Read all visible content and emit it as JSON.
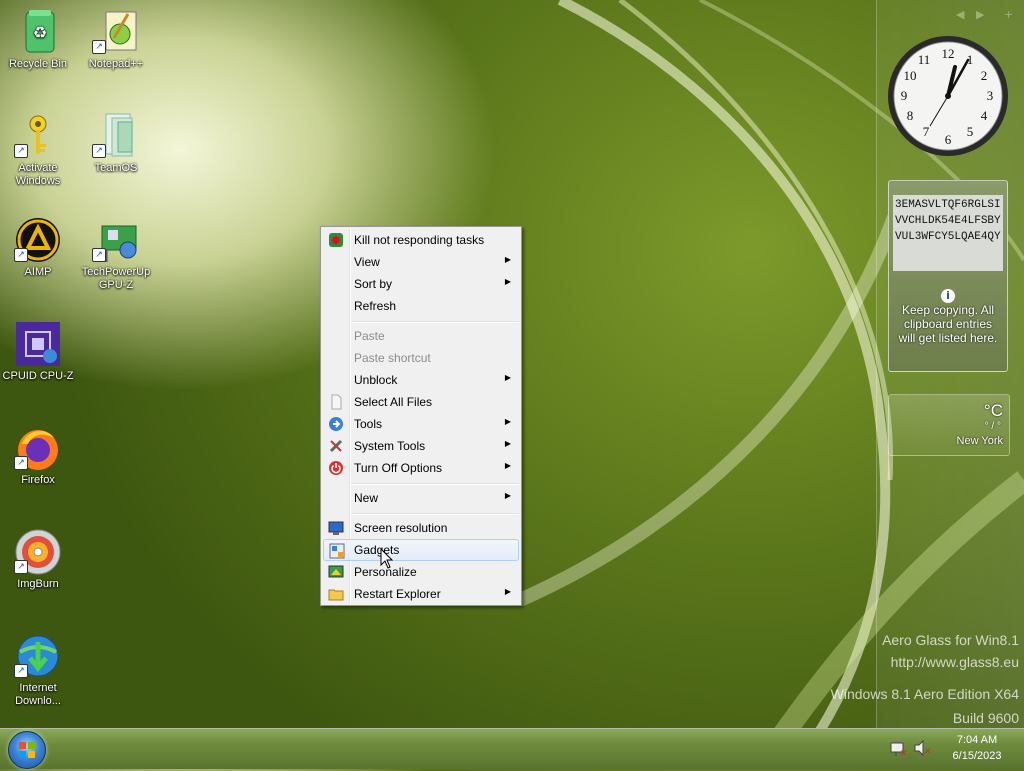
{
  "desktop": {
    "icons": [
      {
        "label": "Recycle Bin",
        "icon": "recycle-bin-icon"
      },
      {
        "label": "Notepad++",
        "icon": "notepad-plus-plus-icon"
      },
      {
        "label": "Activate Windows",
        "icon": "key-icon"
      },
      {
        "label": "TeamOS",
        "icon": "teamos-icon"
      },
      {
        "label": "AIMP",
        "icon": "aimp-icon"
      },
      {
        "label": "TechPowerUp GPU-Z",
        "icon": "gpu-z-icon"
      },
      {
        "label": "CPUID CPU-Z",
        "icon": "cpu-z-icon"
      },
      {
        "label": "Firefox",
        "icon": "firefox-icon"
      },
      {
        "label": "ImgBurn",
        "icon": "imgburn-icon"
      },
      {
        "label": "Internet Downlo...",
        "icon": "internet-download-manager-icon"
      }
    ]
  },
  "sidebar": {
    "controls": [
      "◀",
      "▶",
      "+"
    ],
    "clock": {
      "time": "7:04"
    },
    "clipboard": {
      "content": "3EMASVLTQF6RGLSIVVCHLDK54E4LFSBYVUL3WFCY5LQAE4QY",
      "info_icon": "i",
      "message": "Keep copying. All clipboard entries will get listed here."
    },
    "weather": {
      "unit": "°C",
      "range": "° / °",
      "city": "New York"
    }
  },
  "watermark": {
    "line1": "Aero Glass for Win8.1",
    "line2": "http://www.glass8.eu",
    "line3": "Windows 8.1 Aero Edition X64",
    "line4": "Build 9600"
  },
  "context_menu": {
    "items": [
      {
        "label": "Kill not responding tasks",
        "icon": "kill-task-icon",
        "submenu": false,
        "disabled": false
      },
      {
        "label": "View",
        "submenu": true,
        "disabled": false
      },
      {
        "label": "Sort by",
        "submenu": true,
        "disabled": false
      },
      {
        "label": "Refresh",
        "submenu": false,
        "disabled": false
      },
      {
        "label": "Paste",
        "submenu": false,
        "disabled": true
      },
      {
        "label": "Paste shortcut",
        "submenu": false,
        "disabled": true
      },
      {
        "label": "Unblock",
        "submenu": true,
        "disabled": false
      },
      {
        "label": "Select All Files",
        "icon": "file-icon",
        "submenu": false,
        "disabled": false
      },
      {
        "label": "Tools",
        "icon": "tools-arrow-icon",
        "submenu": true,
        "disabled": false
      },
      {
        "label": "System Tools",
        "icon": "wrench-icon",
        "submenu": true,
        "disabled": false
      },
      {
        "label": "Turn Off Options",
        "icon": "power-icon",
        "submenu": true,
        "disabled": false
      },
      {
        "label": "New",
        "submenu": true,
        "disabled": false
      },
      {
        "label": "Screen resolution",
        "icon": "monitor-icon",
        "submenu": false,
        "disabled": false
      },
      {
        "label": "Gadgets",
        "icon": "gadgets-icon",
        "submenu": false,
        "disabled": false,
        "hover": true
      },
      {
        "label": "Personalize",
        "icon": "personalize-icon",
        "submenu": false,
        "disabled": false
      },
      {
        "label": "Restart Explorer",
        "icon": "folder-icon",
        "submenu": true,
        "disabled": false
      }
    ],
    "submenu_glyph": "▶"
  },
  "taskbar": {
    "clock_time": "7:04 AM",
    "clock_date": "6/15/2023",
    "tray_icons": [
      "network-icon",
      "volume-muted-icon"
    ]
  },
  "colors": {
    "menu_bg": "#f0f0f0",
    "hover_border": "#aecff7",
    "disabled_text": "#8c8c8c"
  }
}
